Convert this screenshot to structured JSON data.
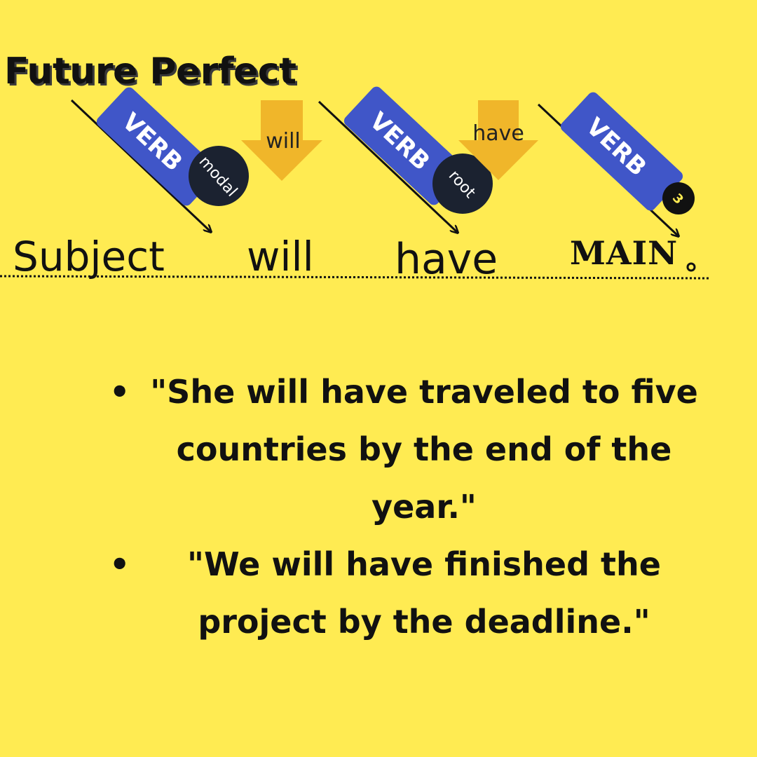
{
  "title": "Future Perfect",
  "tags": [
    {
      "label": "VERB",
      "badge": "modal"
    },
    {
      "label": "VERB",
      "badge": "root"
    },
    {
      "label": "VERB",
      "badge": "3"
    }
  ],
  "down_arrows": [
    "will",
    "have"
  ],
  "sentence": {
    "subject": "Subject",
    "will": "will",
    "have": "have",
    "main": "MAIN"
  },
  "examples": [
    "\"She will have traveled to five countries by the end of the year.\"",
    "\"We will have finished the project by the deadline.\""
  ],
  "colors": {
    "background": "#FFEB52",
    "tag": "#4056C8",
    "badge": "#1B2230",
    "down_arrow": "#F0B62A",
    "text": "#111111"
  }
}
